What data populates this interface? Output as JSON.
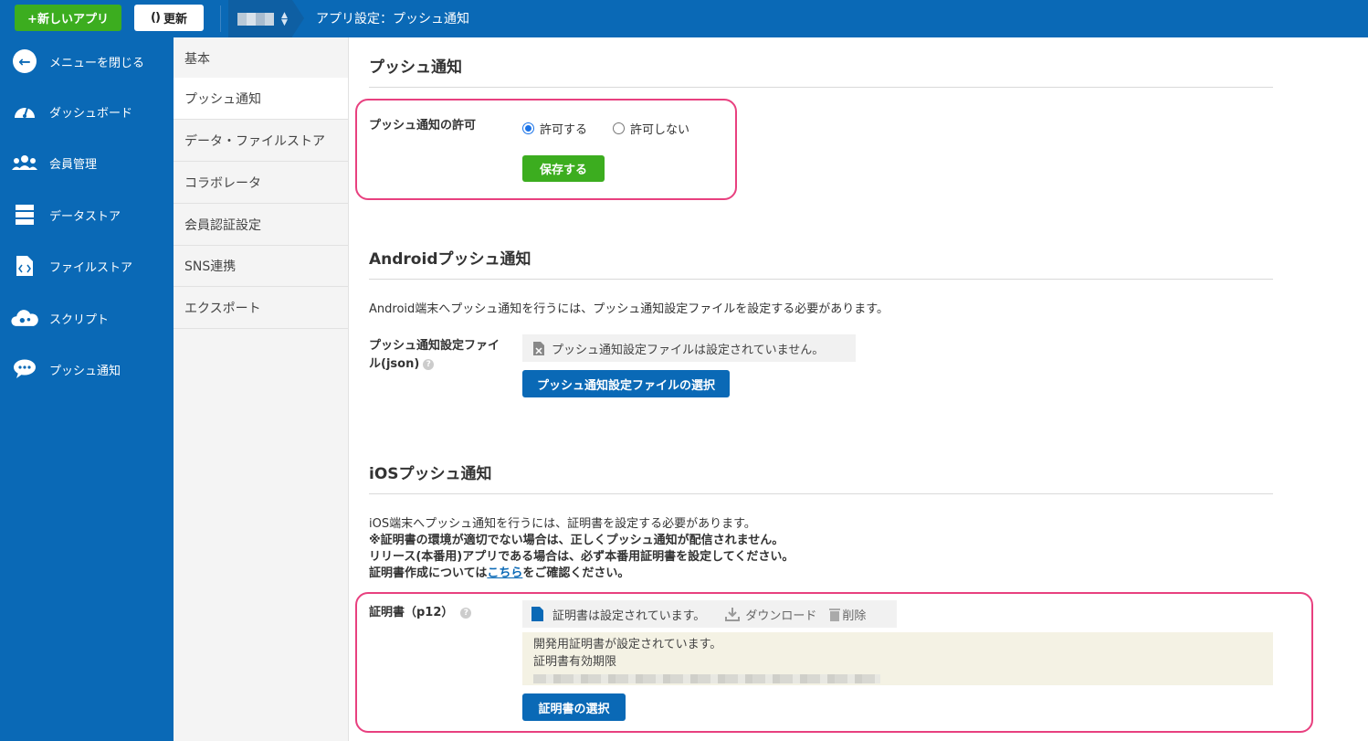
{
  "topbar": {
    "new_app": "+新しいアプリ",
    "refresh_icon": "()",
    "refresh": "更新",
    "title": "アプリ設定：プッシュ通知"
  },
  "sidebar": {
    "items": [
      {
        "label": "メニューを閉じる",
        "icon": "arrow-left-icon"
      },
      {
        "label": "ダッシュボード",
        "icon": "gauge-icon"
      },
      {
        "label": "会員管理",
        "icon": "users-icon"
      },
      {
        "label": "データストア",
        "icon": "database-icon"
      },
      {
        "label": "ファイルストア",
        "icon": "file-code-icon"
      },
      {
        "label": "スクリプト",
        "icon": "cloud-gear-icon"
      },
      {
        "label": "プッシュ通知",
        "icon": "chat-bubble-icon"
      }
    ]
  },
  "subnav": {
    "items": [
      "基本",
      "プッシュ通知",
      "データ・ファイルストア",
      "コラボレータ",
      "会員認証設定",
      "SNS連携",
      "エクスポート"
    ],
    "active_index": 1
  },
  "push": {
    "heading": "プッシュ通知",
    "permission_label": "プッシュ通知の許可",
    "allow": "許可する",
    "deny": "許可しない",
    "selected": "allow",
    "save": "保存する"
  },
  "android": {
    "heading": "Androidプッシュ通知",
    "description": "Android端末へプッシュ通知を行うには、プッシュ通知設定ファイルを設定する必要があります。",
    "file_label_1": "プッシュ通知設定ファイ",
    "file_label_2": "ル(json)",
    "help": "?",
    "status": "プッシュ通知設定ファイルは設定されていません。",
    "select_button": "プッシュ通知設定ファイルの選択"
  },
  "ios": {
    "heading": "iOSプッシュ通知",
    "line1": "iOS端末へプッシュ通知を行うには、証明書を設定する必要があります。",
    "line2": "※証明書の環境が適切でない場合は、正しくプッシュ通知が配信されません。",
    "line3": "リリース(本番用)アプリである場合は、必ず本番用証明書を設定してください。",
    "line4_pre": "証明書作成については",
    "line4_link": "こちら",
    "line4_post": "をご確認ください。",
    "cert_label": "証明書（p12）",
    "help": "?",
    "cert_status": "証明書は設定されています。",
    "download": "ダウンロード",
    "delete": "削除",
    "info_line1": "開発用証明書が設定されています。",
    "info_line2": "証明書有効期限",
    "select_button": "証明書の選択"
  },
  "colors": {
    "primary_blue": "#0a69b6",
    "green": "#3cad1f",
    "highlight_pink": "#e8407f"
  }
}
